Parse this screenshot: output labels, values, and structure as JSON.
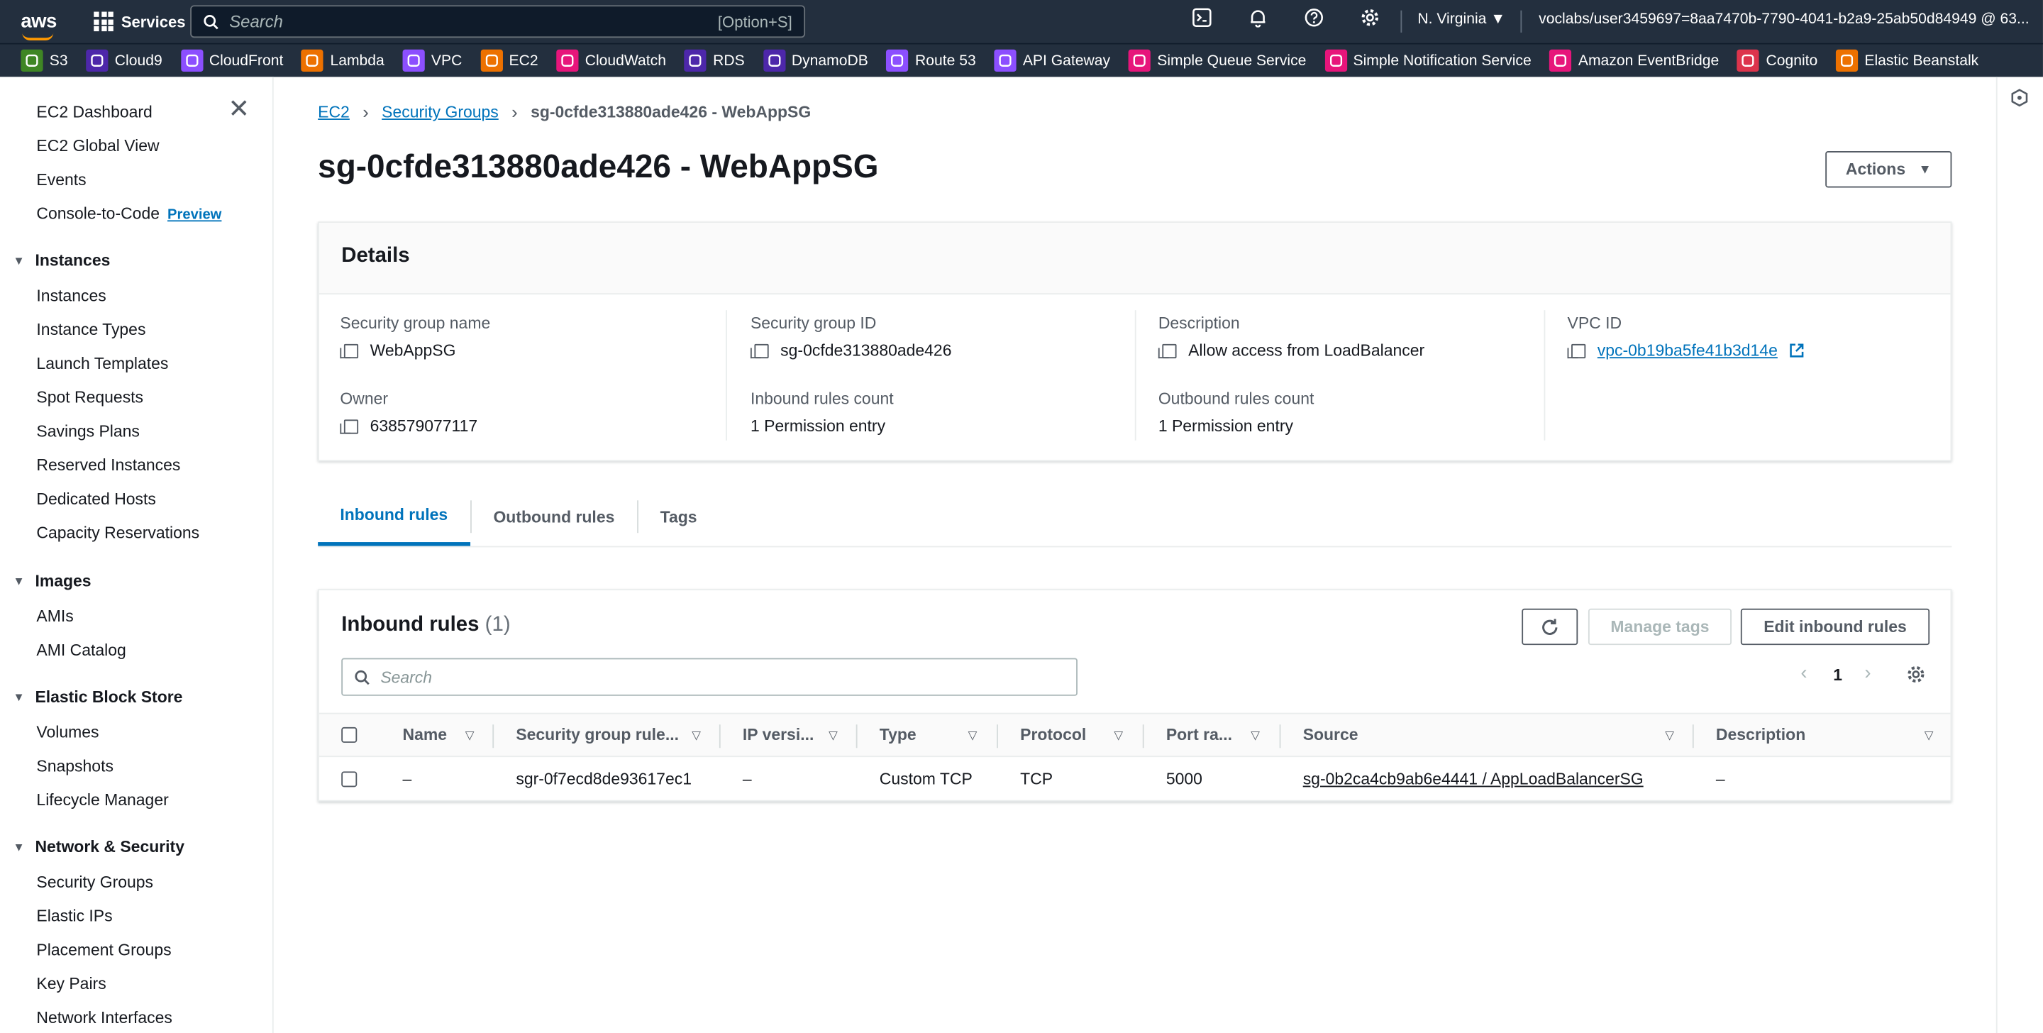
{
  "topnav": {
    "logo": "aws",
    "services_label": "Services",
    "search_placeholder": "Search",
    "search_shortcut": "[Option+S]",
    "region": "N. Virginia",
    "user": "voclabs/user3459697=8aa7470b-7790-4041-b2a9-25ab50d84949 @ 63...",
    "icons": [
      "cloudshell-icon",
      "bell-icon",
      "help-icon",
      "gear-icon"
    ]
  },
  "favorites": [
    {
      "label": "S3",
      "color": "#3f8624",
      "icon": "s3-icon"
    },
    {
      "label": "Cloud9",
      "color": "#4d27aa",
      "icon": "cloud9-icon"
    },
    {
      "label": "CloudFront",
      "color": "#8c4fff",
      "icon": "cloudfront-icon"
    },
    {
      "label": "Lambda",
      "color": "#ed7100",
      "icon": "lambda-icon"
    },
    {
      "label": "VPC",
      "color": "#8c4fff",
      "icon": "vpc-icon"
    },
    {
      "label": "EC2",
      "color": "#ed7100",
      "icon": "ec2-icon"
    },
    {
      "label": "CloudWatch",
      "color": "#e7157b",
      "icon": "cloudwatch-icon"
    },
    {
      "label": "RDS",
      "color": "#4d27aa",
      "icon": "rds-icon"
    },
    {
      "label": "DynamoDB",
      "color": "#4d27aa",
      "icon": "dynamodb-icon"
    },
    {
      "label": "Route 53",
      "color": "#8c4fff",
      "icon": "route53-icon"
    },
    {
      "label": "API Gateway",
      "color": "#8c4fff",
      "icon": "api-gateway-icon"
    },
    {
      "label": "Simple Queue Service",
      "color": "#e7157b",
      "icon": "sqs-icon"
    },
    {
      "label": "Simple Notification Service",
      "color": "#e7157b",
      "icon": "sns-icon"
    },
    {
      "label": "Amazon EventBridge",
      "color": "#e7157b",
      "icon": "eventbridge-icon"
    },
    {
      "label": "Cognito",
      "color": "#dd344c",
      "icon": "cognito-icon"
    },
    {
      "label": "Elastic Beanstalk",
      "color": "#ed7100",
      "icon": "beanstalk-icon"
    }
  ],
  "sidebar": {
    "top_links": [
      "EC2 Dashboard",
      "EC2 Global View",
      "Events",
      "Console-to-Code"
    ],
    "preview_label": "Preview",
    "sections": [
      {
        "title": "Instances",
        "items": [
          "Instances",
          "Instance Types",
          "Launch Templates",
          "Spot Requests",
          "Savings Plans",
          "Reserved Instances",
          "Dedicated Hosts",
          "Capacity Reservations"
        ]
      },
      {
        "title": "Images",
        "items": [
          "AMIs",
          "AMI Catalog"
        ]
      },
      {
        "title": "Elastic Block Store",
        "items": [
          "Volumes",
          "Snapshots",
          "Lifecycle Manager"
        ]
      },
      {
        "title": "Network & Security",
        "items": [
          "Security Groups",
          "Elastic IPs",
          "Placement Groups",
          "Key Pairs",
          "Network Interfaces"
        ]
      }
    ]
  },
  "breadcrumb": {
    "items": [
      "EC2",
      "Security Groups"
    ],
    "current": "sg-0cfde313880ade426 - WebAppSG"
  },
  "page": {
    "title": "sg-0cfde313880ade426 - WebAppSG",
    "actions_label": "Actions"
  },
  "details": {
    "heading": "Details",
    "fields": [
      {
        "key": "Security group name",
        "value": "WebAppSG"
      },
      {
        "key": "Security group ID",
        "value": "sg-0cfde313880ade426"
      },
      {
        "key": "Description",
        "value": "Allow access from LoadBalancer"
      },
      {
        "key": "VPC ID",
        "value": "vpc-0b19ba5fe41b3d14e"
      },
      {
        "key": "Owner",
        "value": "638579077117"
      },
      {
        "key": "Inbound rules count",
        "value": "1 Permission entry"
      },
      {
        "key": "Outbound rules count",
        "value": "1 Permission entry"
      }
    ]
  },
  "tabs": [
    "Inbound rules",
    "Outbound rules",
    "Tags"
  ],
  "inbound": {
    "title": "Inbound rules",
    "count": "(1)",
    "manage_tags_label": "Manage tags",
    "edit_label": "Edit inbound rules",
    "search_placeholder": "Search",
    "page": "1",
    "columns": [
      "Name",
      "Security group rule...",
      "IP versi...",
      "Type",
      "Protocol",
      "Port ra...",
      "Source",
      "Description"
    ],
    "rows": [
      [
        "–",
        "sgr-0f7ecd8de93617ec1",
        "–",
        "Custom TCP",
        "TCP",
        "5000",
        "sg-0b2ca4cb9ab6e4441 / AppLoadBalancerSG",
        "–"
      ]
    ]
  }
}
